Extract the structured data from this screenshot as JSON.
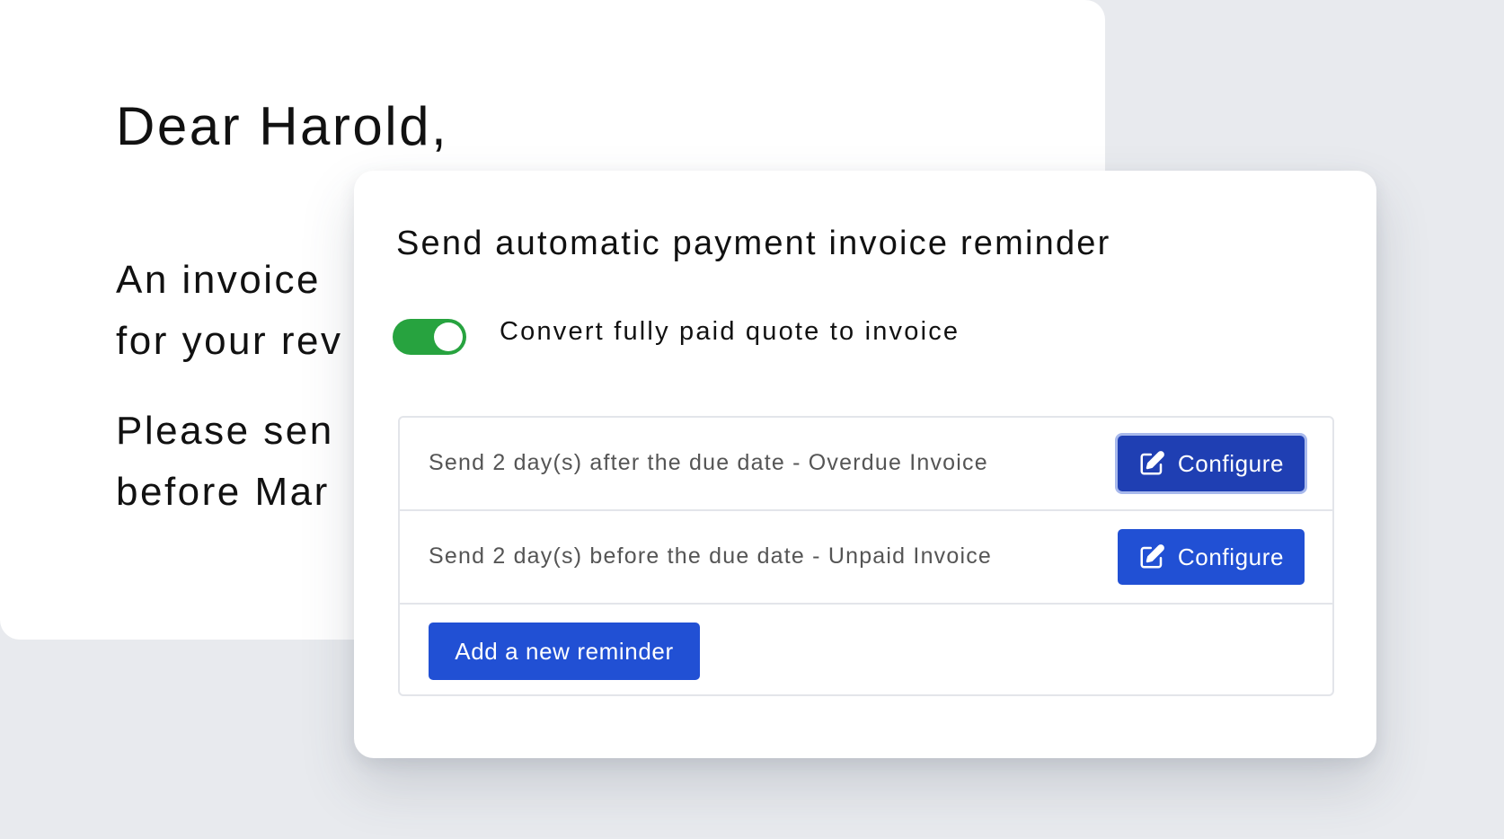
{
  "letter": {
    "greeting": "Dear Harold,",
    "lines": [
      "An invoice",
      "for your rev",
      "Please sen",
      "before Mar"
    ]
  },
  "reminder_panel": {
    "title": "Send automatic payment invoice reminder",
    "toggle": {
      "label": "Convert fully paid quote to invoice",
      "state": "on",
      "color": "#27a33f"
    },
    "reminders": [
      {
        "text": "Send 2 day(s) after the due date - Overdue Invoice",
        "button_label": "Configure",
        "button_icon": "edit-icon"
      },
      {
        "text": "Send 2 day(s) before the due date - Unpaid Invoice",
        "button_label": "Configure",
        "button_icon": "edit-icon"
      }
    ],
    "add_button_label": "Add a new reminder",
    "accent_color": "#2150d4"
  }
}
